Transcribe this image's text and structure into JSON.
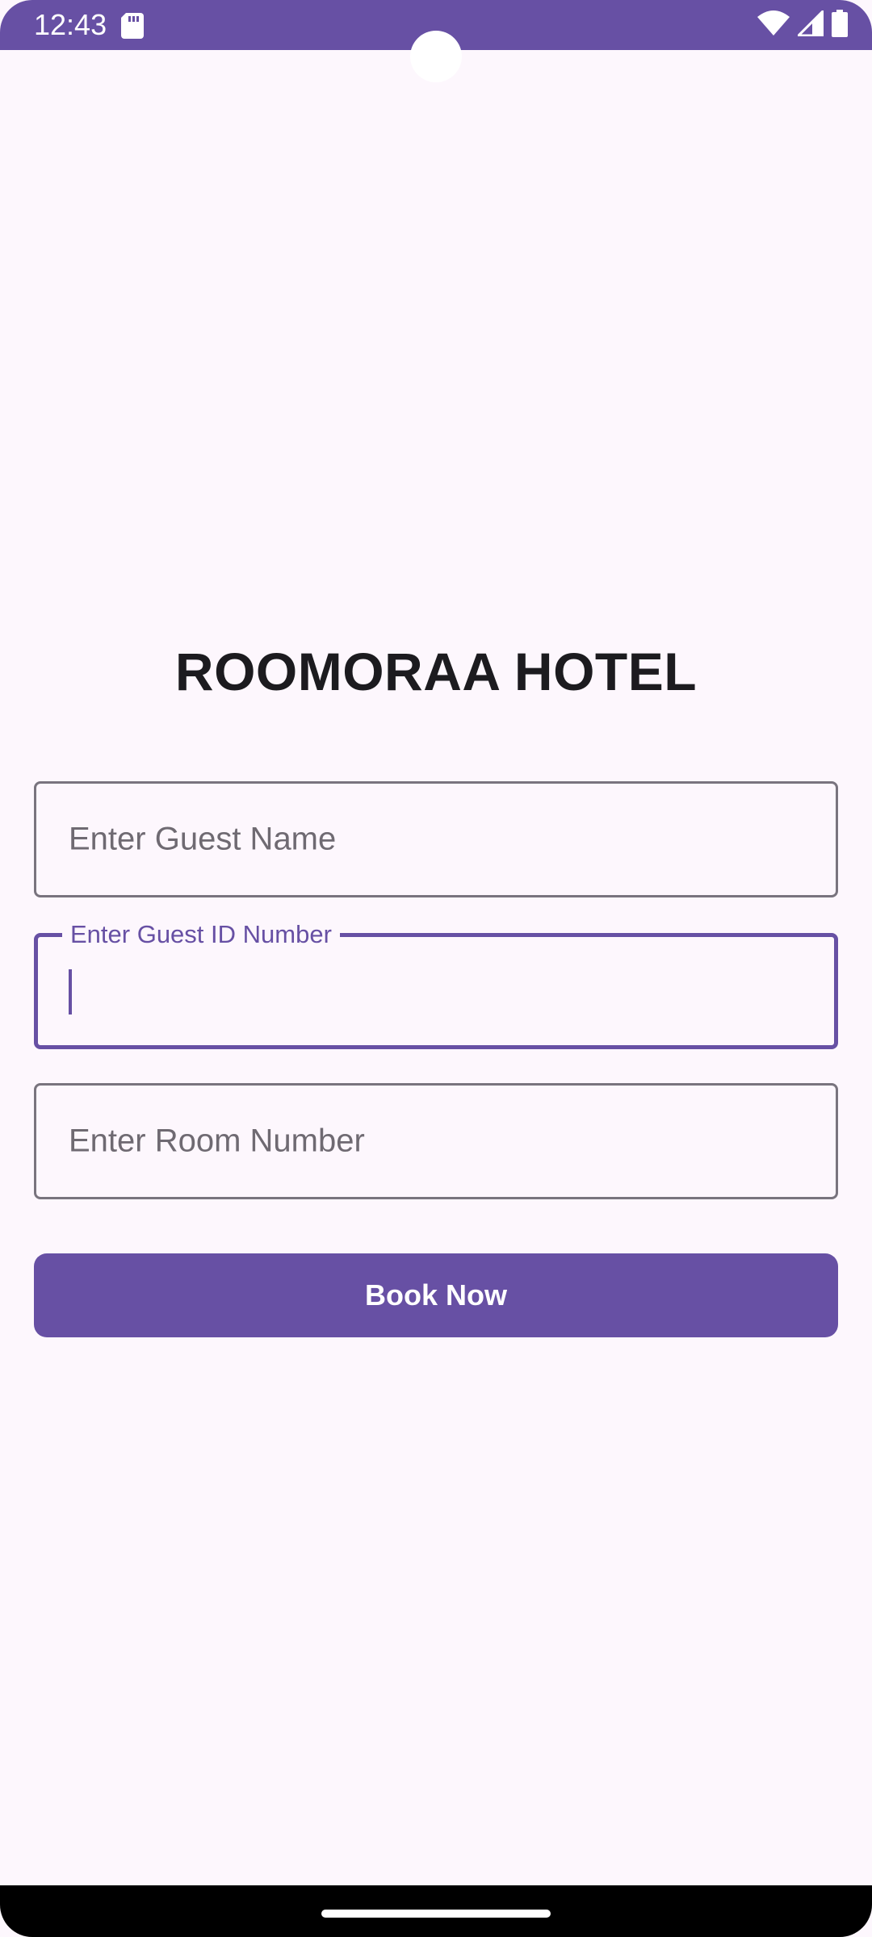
{
  "status_bar": {
    "time": "12:43",
    "left_icons": [
      "sd-card-icon"
    ],
    "right_icons": [
      "wifi-icon",
      "cellular-signal-icon",
      "battery-icon"
    ],
    "background": "#6750A4"
  },
  "app": {
    "title": "ROOMORAA HOTEL"
  },
  "form": {
    "guest_name": {
      "placeholder": "Enter Guest Name",
      "value": ""
    },
    "guest_id": {
      "label": "Enter Guest ID Number",
      "value": "",
      "focused": true
    },
    "room_number": {
      "placeholder": "Enter Room Number",
      "value": ""
    },
    "submit_label": "Book Now"
  },
  "colors": {
    "primary": "#6750A4",
    "background": "#FDF7FD",
    "outline": "#79747E",
    "title_text": "#1C1B1F"
  }
}
